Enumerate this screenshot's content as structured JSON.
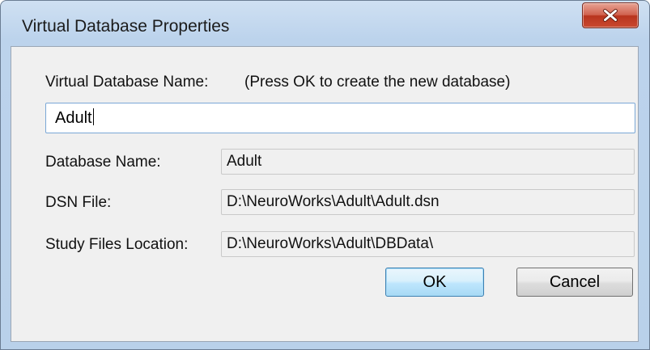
{
  "window": {
    "title": "Virtual Database Properties"
  },
  "form": {
    "virtual_db_name_label": "Virtual Database Name:",
    "hint": "(Press OK to create the new database)",
    "virtual_db_name_value": "Adult",
    "database_name_label": "Database Name:",
    "database_name_value": "Adult",
    "dsn_file_label": "DSN File:",
    "dsn_file_value": "D:\\NeuroWorks\\Adult\\Adult.dsn",
    "study_files_label": "Study Files Location:",
    "study_files_value": "D:\\NeuroWorks\\Adult\\DBData\\"
  },
  "buttons": {
    "ok_label": "OK",
    "cancel_label": "Cancel"
  },
  "colors": {
    "close_button": "#c9482f",
    "ok_border": "#3c7fb1",
    "input_border": "#7aa7d6"
  }
}
